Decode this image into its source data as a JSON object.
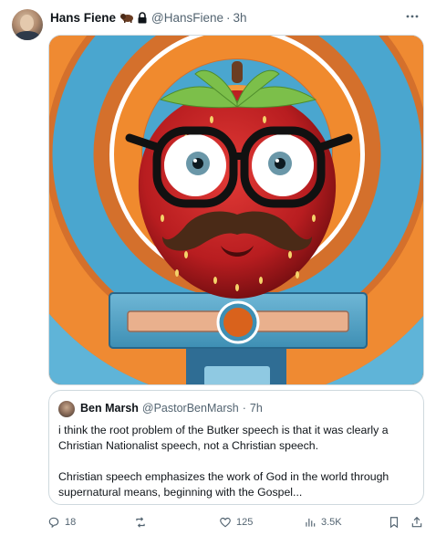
{
  "tweet": {
    "author_name": "Hans Fiene",
    "author_handle": "@HansFiene",
    "time": "3h",
    "separator": "·",
    "media": {
      "description_icon": "strawberry-with-glasses-and-mustache-image"
    }
  },
  "quote": {
    "author_name": "Ben Marsh",
    "author_handle": "@PastorBenMarsh",
    "time": "7h",
    "separator": "·",
    "paragraph1": "i think the root problem of the Butker speech is that it was clearly a Christian Nationalist speech, not a Christian speech.",
    "paragraph2": "Christian speech emphasizes the work of God in the world through supernatural means, beginning with the Gospel..."
  },
  "actions": {
    "replies": "18",
    "retweets": "",
    "likes": "125",
    "views": "3.5K"
  },
  "colors": {
    "text": "#0f1419",
    "muted": "#536471",
    "border": "#cfd9de"
  }
}
